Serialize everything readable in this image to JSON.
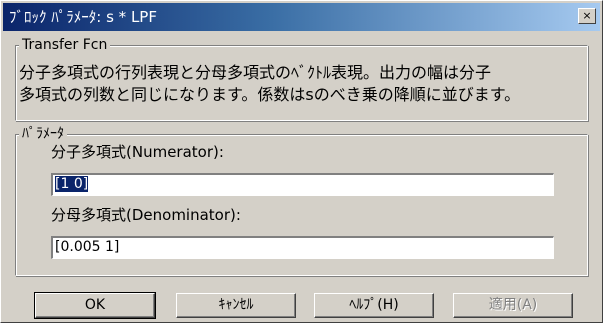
{
  "window": {
    "title": "ﾌﾞﾛｯｸ ﾊﾟﾗﾒｰﾀ: s * LPF",
    "close_symbol": "×"
  },
  "description_group": {
    "legend": "Transfer Fcn",
    "lines": [
      "分子多項式の行列表現と分母多項式のﾍﾞｸﾄﾙ表現。出力の幅は分子",
      "多項式の列数と同じになります。係数はsのべき乗の降順に並びます。"
    ]
  },
  "parameters_group": {
    "legend": "ﾊﾟﾗﾒｰﾀ",
    "numerator": {
      "label": "分子多項式(Numerator):",
      "value": "[1 0]"
    },
    "denominator": {
      "label": "分母多項式(Denominator):",
      "value": "[0.005 1]"
    }
  },
  "buttons": {
    "ok": "OK",
    "cancel": "ｷｬﾝｾﾙ",
    "help": "ﾍﾙﾌﾟ(H)",
    "apply": "適用(A)"
  },
  "colors": {
    "titlebar_start": "#0a246a",
    "titlebar_end": "#a6caf0",
    "face": "#d4d0c8",
    "selection": "#0a246a"
  }
}
